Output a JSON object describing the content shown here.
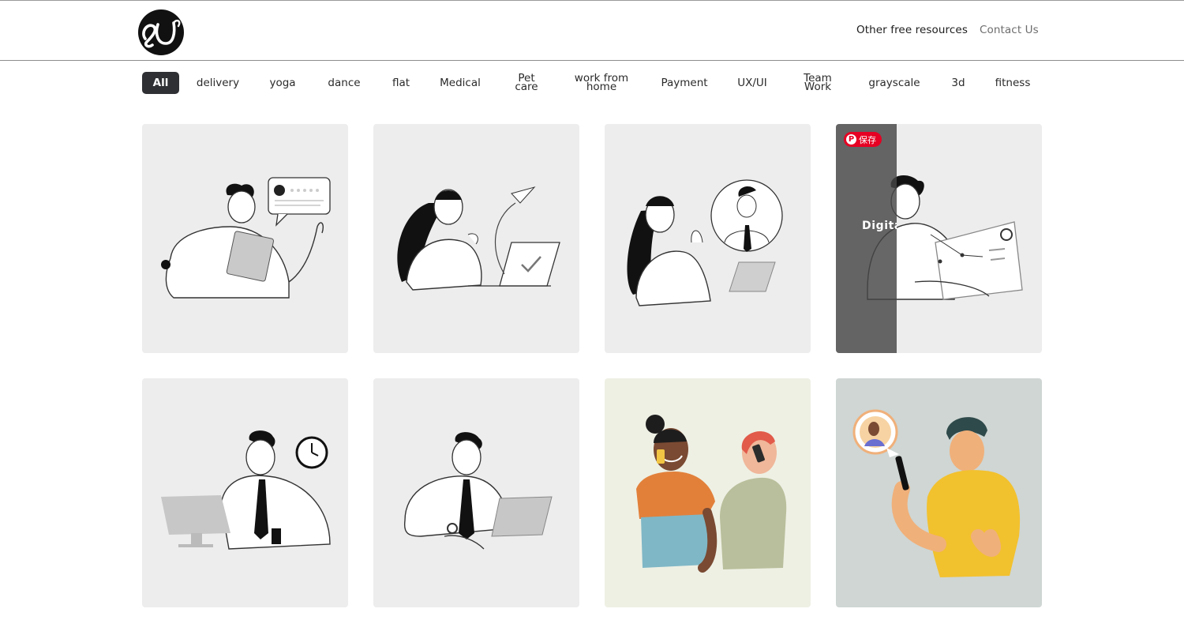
{
  "header": {
    "logo_text": "SU",
    "nav": [
      {
        "label": "Other free resources"
      },
      {
        "label": "Contact Us"
      }
    ]
  },
  "filters": [
    {
      "label": "All",
      "active": true
    },
    {
      "label": "delivery"
    },
    {
      "label": "yoga"
    },
    {
      "label": "dance"
    },
    {
      "label": "flat"
    },
    {
      "label": "Medical"
    },
    {
      "label": "Pet care"
    },
    {
      "label": "work from home"
    },
    {
      "label": "Payment"
    },
    {
      "label": "UX/UI"
    },
    {
      "label": "Team Work"
    },
    {
      "label": "grayscale"
    },
    {
      "label": "3d"
    },
    {
      "label": "fitness"
    }
  ],
  "cards": [
    {
      "illustration": "man-tablet-feedback"
    },
    {
      "illustration": "woman-laptop-paper-plane"
    },
    {
      "illustration": "woman-video-call"
    },
    {
      "illustration": "man-drawing-tablet",
      "hover_title": "Digital",
      "save_label": "保存",
      "save_icon": "pinterest-icon"
    },
    {
      "illustration": "man-desk-clock"
    },
    {
      "illustration": "man-laptop-tie"
    },
    {
      "illustration": "two-people-phone-call"
    },
    {
      "illustration": "man-phone-chat"
    }
  ],
  "colors": {
    "card_bg": "#ededed",
    "card_bg_warm": "#eef0e4",
    "card_bg_cool": "#cfd6d3",
    "active_chip": "#2e3033",
    "save_red": "#e60023"
  }
}
